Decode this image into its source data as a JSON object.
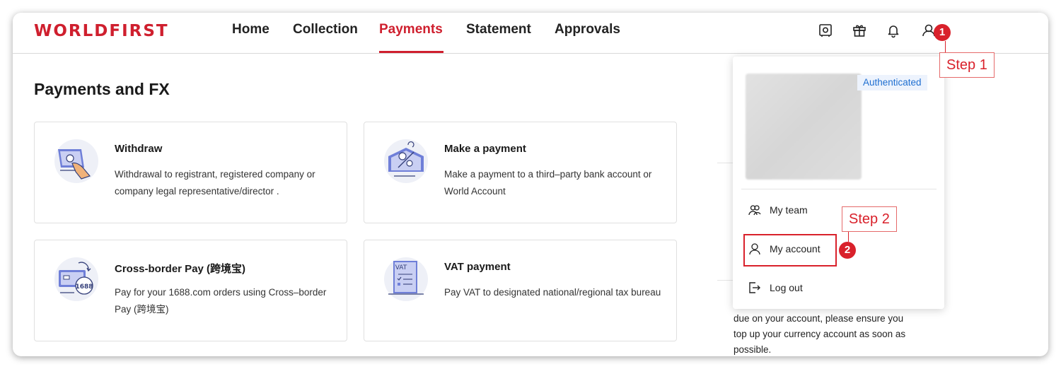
{
  "brand": {
    "logo_text": "WORLDFIRST",
    "accent_color": "#cf1f2e"
  },
  "nav": {
    "items": [
      {
        "label": "Home"
      },
      {
        "label": "Collection"
      },
      {
        "label": "Payments",
        "active": true
      },
      {
        "label": "Statement"
      },
      {
        "label": "Approvals"
      }
    ]
  },
  "header_icons": [
    "safe-icon",
    "gift-icon",
    "bell-icon",
    "user-icon"
  ],
  "page": {
    "title": "Payments and FX"
  },
  "cards": [
    {
      "title": "Withdraw",
      "desc": "Withdrawal to registrant, registered company or company legal representative/director .",
      "icon": "withdraw-icon"
    },
    {
      "title": "Make a payment",
      "desc": "Make a payment to a third–party bank account or World Account",
      "icon": "make-payment-icon"
    },
    {
      "title": "Cross-border Pay (跨境宝)",
      "desc": "Pay for your 1688.com orders using Cross–border Pay (跨境宝)",
      "icon": "cross-border-pay-icon",
      "icon_text": "1688"
    },
    {
      "title": "VAT payment",
      "desc": "Pay VAT to designated national/regional tax bureau",
      "icon": "vat-icon",
      "icon_text": "VAT"
    }
  ],
  "side_notice": {
    "text": "due on your account, please ensure you top up your currency account as soon as possible."
  },
  "dropdown": {
    "badge": "Authenticated",
    "items": [
      {
        "label": "My team",
        "icon": "team-icon"
      },
      {
        "label": "My account",
        "icon": "user-icon"
      },
      {
        "label": "Log out",
        "icon": "logout-icon"
      }
    ]
  },
  "annotations": {
    "step1": {
      "label": "Step 1",
      "number": "1"
    },
    "step2": {
      "label": "Step 2",
      "number": "2"
    },
    "color": "#d9212b"
  }
}
